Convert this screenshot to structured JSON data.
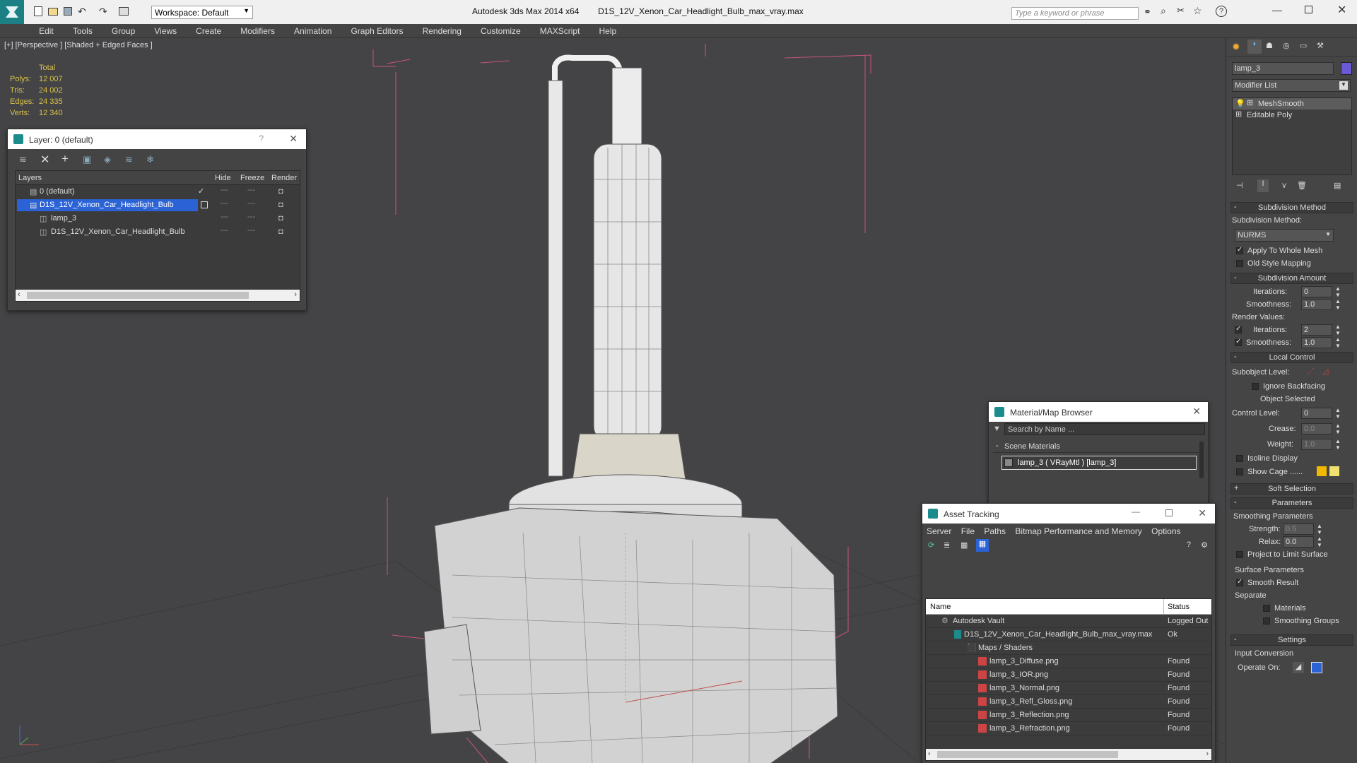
{
  "app": {
    "title": "Autodesk 3ds Max  2014 x64",
    "file": "D1S_12V_Xenon_Car_Headlight_Bulb_max_vray.max",
    "workspace": "Workspace: Default",
    "search_placeholder": "Type a keyword or phrase"
  },
  "menu": [
    "Edit",
    "Tools",
    "Group",
    "Views",
    "Create",
    "Modifiers",
    "Animation",
    "Graph Editors",
    "Rendering",
    "Customize",
    "MAXScript",
    "Help"
  ],
  "viewport": {
    "label": "[+] [Perspective ] [Shaded + Edged Faces ]",
    "stats": {
      "header": "Total",
      "rows": [
        {
          "label": "Polys:",
          "value": "12 007"
        },
        {
          "label": "Tris:",
          "value": "24 002"
        },
        {
          "label": "Edges:",
          "value": "24 335"
        },
        {
          "label": "Verts:",
          "value": "12 340"
        }
      ]
    }
  },
  "layer_dialog": {
    "title": "Layer: 0 (default)",
    "columns": [
      "Layers",
      "Hide",
      "Freeze",
      "Render"
    ],
    "rows": [
      {
        "name": "0 (default)",
        "selected": false
      },
      {
        "name": "D1S_12V_Xenon_Car_Headlight_Bulb",
        "selected": true
      },
      {
        "name": "lamp_3",
        "selected": false
      },
      {
        "name": "D1S_12V_Xenon_Car_Headlight_Bulb",
        "selected": false
      }
    ]
  },
  "material_browser": {
    "title": "Material/Map Browser",
    "search_placeholder": "Search by Name ...",
    "section": "Scene Materials",
    "item": "lamp_3  ( VRayMtl )  [lamp_3]"
  },
  "asset_tracking": {
    "title": "Asset Tracking",
    "menu": [
      "Server",
      "File",
      "Paths",
      "Bitmap Performance and Memory",
      "Options"
    ],
    "columns": [
      "Name",
      "Status"
    ],
    "rows": [
      {
        "name": "Autodesk Vault",
        "status": "Logged Out"
      },
      {
        "name": "D1S_12V_Xenon_Car_Headlight_Bulb_max_vray.max",
        "status": "Ok"
      },
      {
        "name": "Maps / Shaders",
        "status": ""
      },
      {
        "name": "lamp_3_Diffuse.png",
        "status": "Found"
      },
      {
        "name": "lamp_3_IOR.png",
        "status": "Found"
      },
      {
        "name": "lamp_3_Normal.png",
        "status": "Found"
      },
      {
        "name": "lamp_3_Refl_Gloss.png",
        "status": "Found"
      },
      {
        "name": "lamp_3_Reflection.png",
        "status": "Found"
      },
      {
        "name": "lamp_3_Refraction.png",
        "status": "Found"
      }
    ]
  },
  "command_panel": {
    "object_name": "lamp_3",
    "modifier_list": "Modifier List",
    "stack": [
      "MeshSmooth",
      "Editable Poly"
    ],
    "subdivision_method": {
      "header": "Subdivision Method",
      "label": "Subdivision Method:",
      "value": "NURMS",
      "apply_whole_mesh": "Apply To Whole Mesh",
      "old_style": "Old Style Mapping"
    },
    "subdivision_amount": {
      "header": "Subdivision Amount",
      "iterations_label": "Iterations:",
      "iterations": "0",
      "smoothness_label": "Smoothness:",
      "smoothness": "1.0",
      "render_values": "Render Values:",
      "r_iterations": "2",
      "r_smoothness": "1.0"
    },
    "local_control": {
      "header": "Local Control",
      "subobject": "Subobject Level:",
      "ignore_backfacing": "Ignore Backfacing",
      "object_selected": "Object Selected",
      "control_level_label": "Control Level:",
      "control_level": "0",
      "crease_label": "Crease:",
      "crease": "0.0",
      "weight_label": "Weight:",
      "weight": "1.0",
      "isoline": "Isoline Display",
      "show_cage": "Show Cage ......"
    },
    "soft_selection": "Soft Selection",
    "parameters": {
      "header": "Parameters",
      "smoothing_params": "Smoothing Parameters",
      "strength_label": "Strength:",
      "strength": "0.5",
      "relax_label": "Relax:",
      "relax": "0.0",
      "project": "Project to Limit Surface",
      "surface_params": "Surface Parameters",
      "smooth_result": "Smooth Result",
      "separate": "Separate",
      "materials": "Materials",
      "smoothing_groups": "Smoothing Groups"
    },
    "settings": {
      "header": "Settings",
      "input_conversion": "Input Conversion",
      "operate_on": "Operate On:"
    }
  },
  "colors": {
    "accent": "#1c8b8c",
    "selection": "#2b63d6",
    "stats_yellow": "#d9c24a",
    "bbox_pink": "#c8537a"
  }
}
